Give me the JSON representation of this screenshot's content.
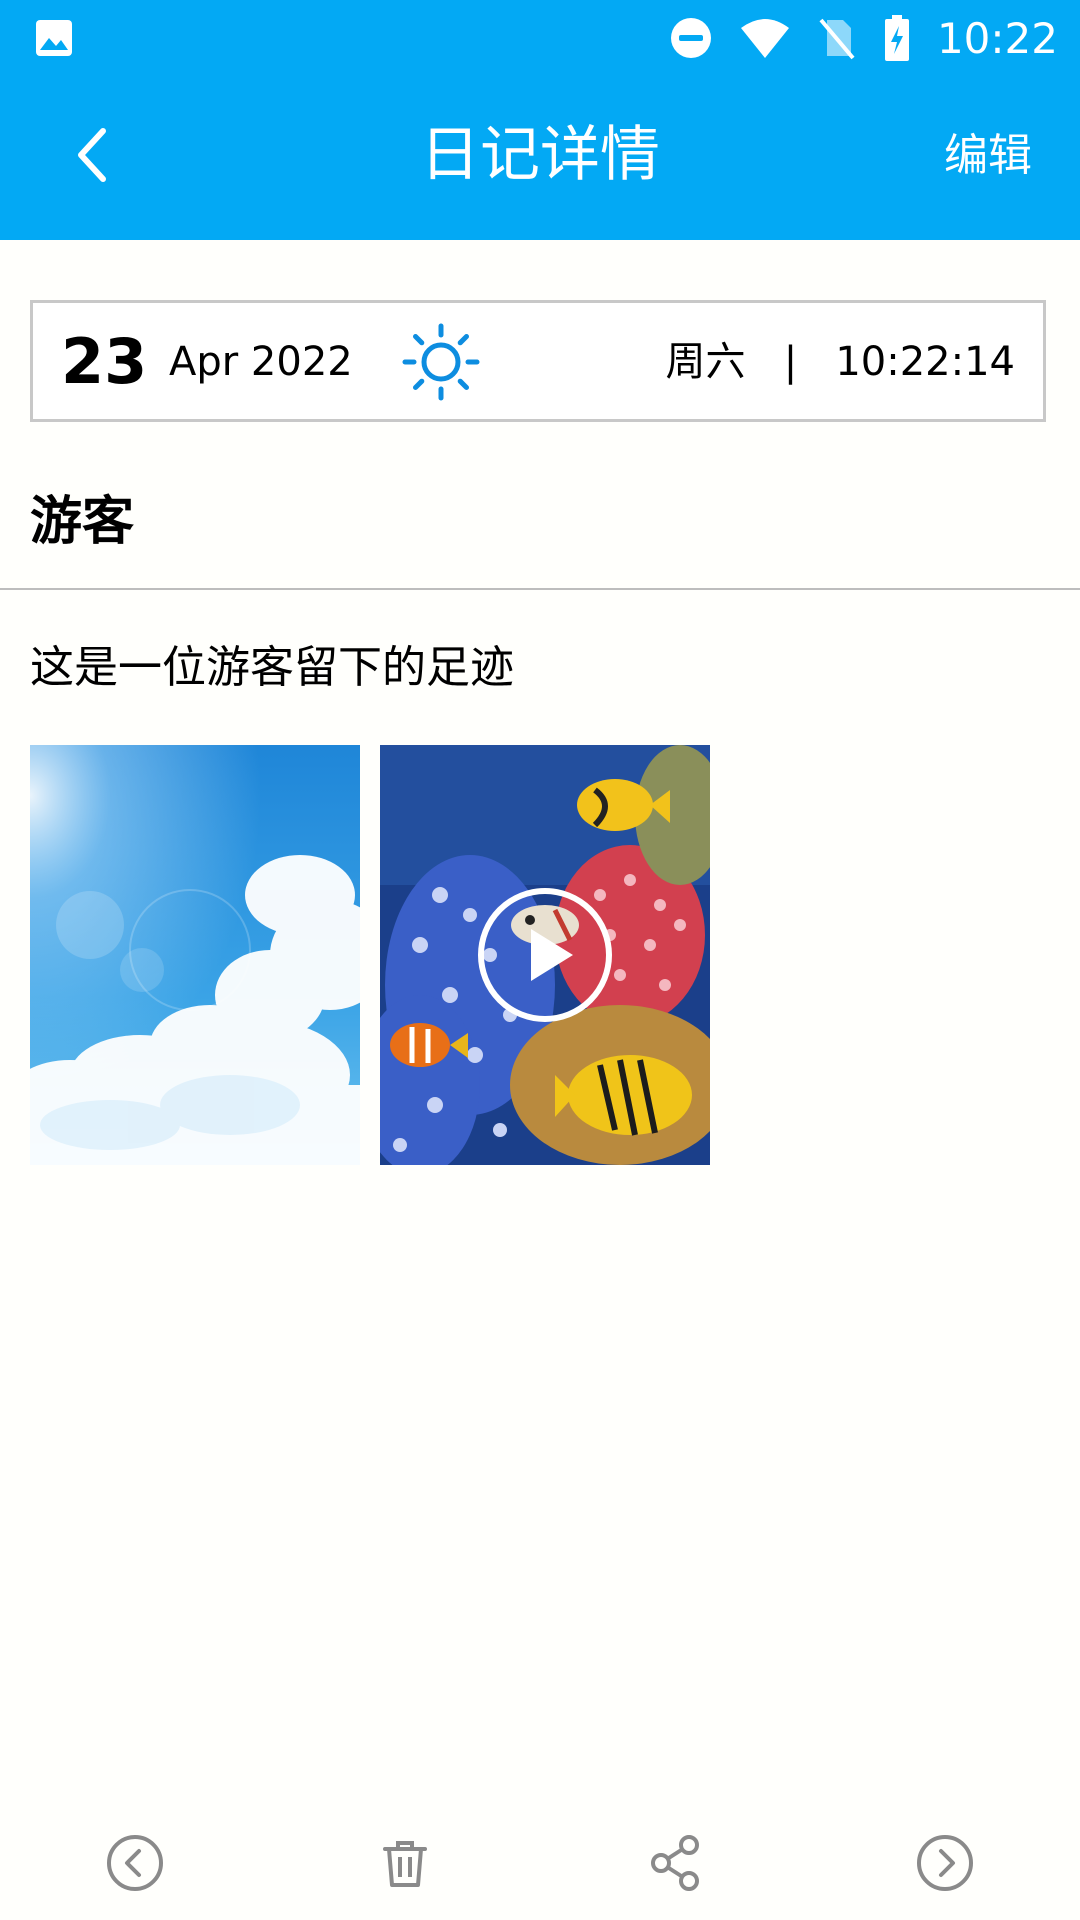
{
  "status_bar": {
    "time": "10:22",
    "left_icons": [
      "gallery-icon"
    ],
    "right_icons": [
      "do-not-disturb-icon",
      "wifi-icon",
      "no-sim-icon",
      "battery-charging-icon"
    ]
  },
  "toolbar": {
    "title": "日记详情",
    "edit_label": "编辑",
    "background_color": "#03a9f4"
  },
  "date_card": {
    "day": "23",
    "month_year": "Apr 2022",
    "weather_icon": "sunny-icon",
    "weekday": "周六",
    "separator": "|",
    "time": "10:22:14",
    "accent_color": "#0d8de0"
  },
  "entry": {
    "title": "游客",
    "body": "这是一位游客留下的足迹",
    "media": [
      {
        "type": "image",
        "subject": "sky-with-clouds"
      },
      {
        "type": "video",
        "subject": "coral-reef-fish"
      }
    ]
  },
  "bottom_bar": {
    "actions": [
      "previous-icon",
      "delete-icon",
      "share-icon",
      "next-icon"
    ]
  }
}
